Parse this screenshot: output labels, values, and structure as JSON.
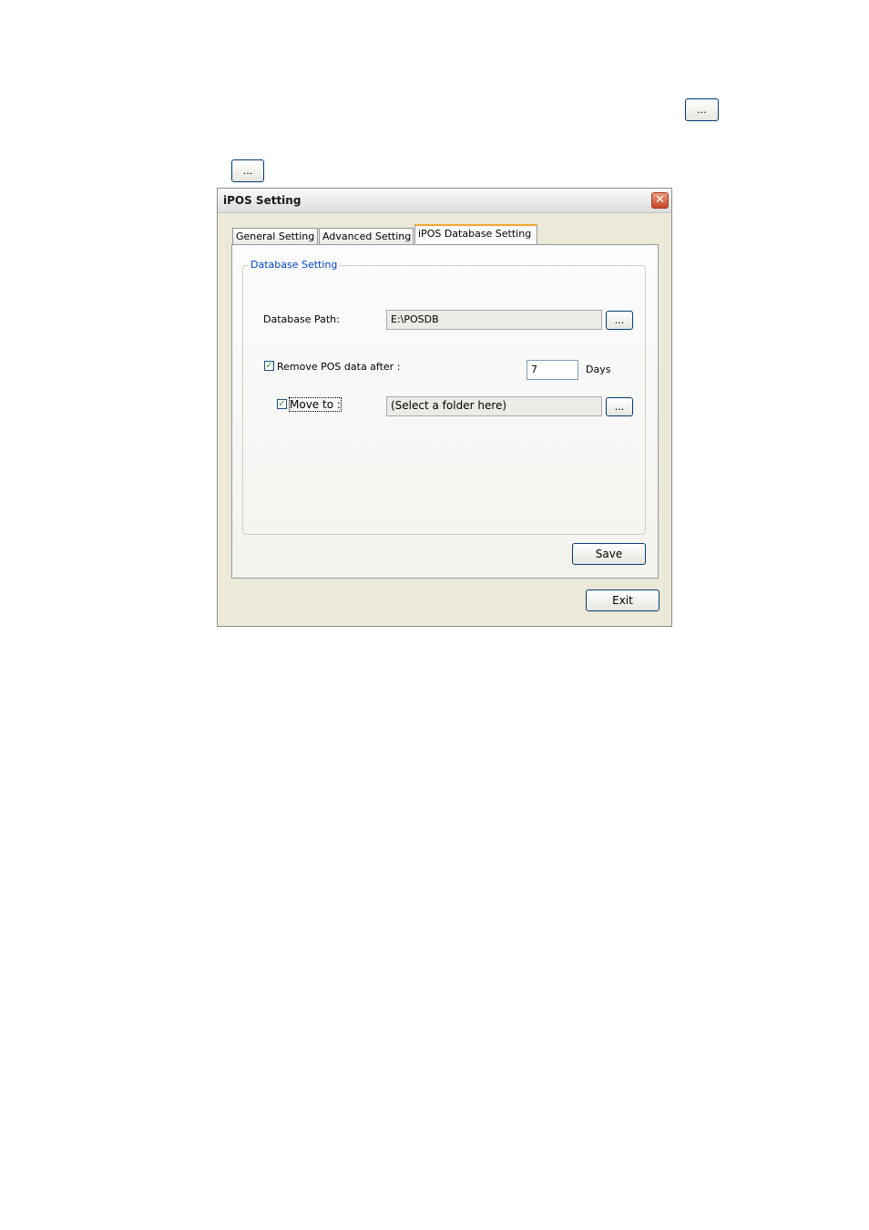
{
  "top_buttons": {
    "browse_1_label": "...",
    "browse_2_label": "..."
  },
  "dialog": {
    "title": "iPOS Setting",
    "close_glyph": "✕",
    "tabs": [
      {
        "label": "General Setting"
      },
      {
        "label": "Advanced Setting"
      },
      {
        "label": "iPOS Database Setting",
        "active": true
      }
    ],
    "group_title": "Database Setting",
    "database_path": {
      "label": "Database Path:",
      "value": "E:\\POSDB",
      "browse_label": "..."
    },
    "remove_pos": {
      "label": "Remove POS data after :",
      "checked": true,
      "check_glyph": "✓",
      "days_value": "7",
      "days_unit": "Days"
    },
    "move_to": {
      "label": "Move to :",
      "checked": true,
      "check_glyph": "✓",
      "value": "(Select a folder here)",
      "browse_label": "..."
    },
    "save_label": "Save",
    "exit_label": "Exit"
  },
  "colors": {
    "accent_tab": "#f1a630",
    "group_title": "#0046d5",
    "close_button": "#c8462a",
    "check": "#21a121"
  }
}
